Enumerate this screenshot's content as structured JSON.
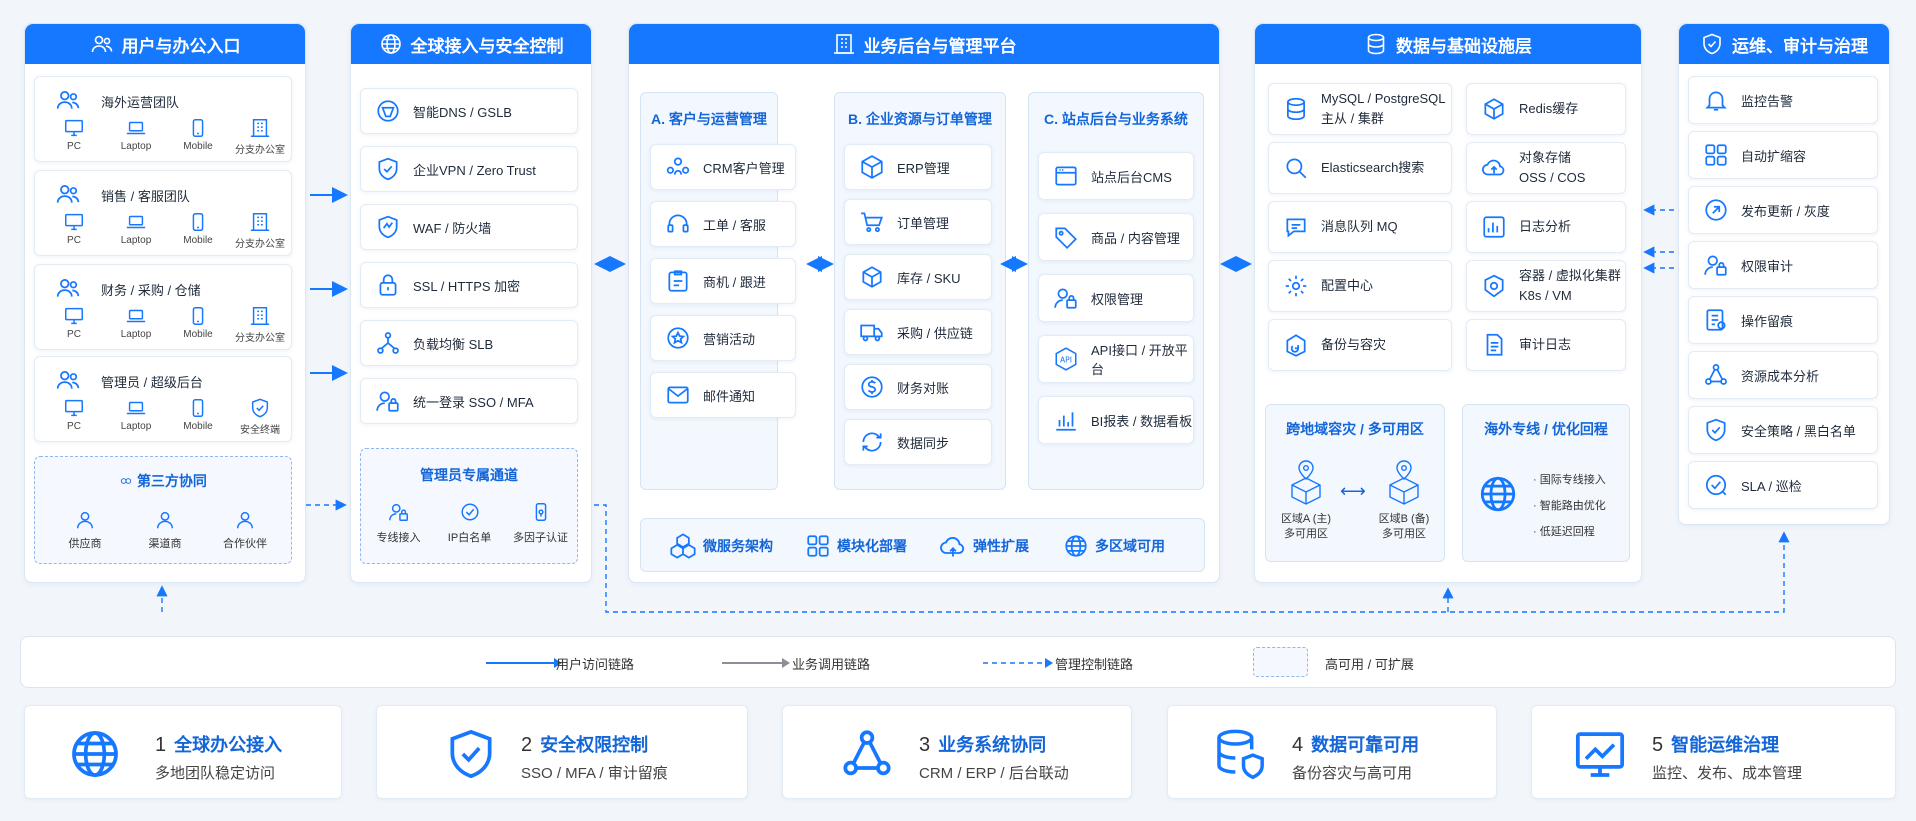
{
  "colors": {
    "accent": "#1677ff",
    "dark_accent": "#1466d8",
    "gray_arrow": "#8a8f98",
    "panel_bg": "#f3f8fe"
  },
  "col1": {
    "title": "用户与办公入口",
    "groups": [
      {
        "title": "海外运营团队",
        "devices": [
          "PC",
          "Laptop",
          "Mobile",
          "分支办公室"
        ]
      },
      {
        "title": "销售 / 客服团队",
        "devices": [
          "PC",
          "Laptop",
          "Mobile",
          "分支办公室"
        ]
      },
      {
        "title": "财务 / 采购 / 仓储",
        "devices": [
          "PC",
          "Laptop",
          "Mobile",
          "分支办公室"
        ]
      },
      {
        "title": "管理员 / 超级后台",
        "devices": [
          "PC",
          "Laptop",
          "Mobile",
          "安全终端"
        ]
      }
    ],
    "third_party": {
      "title": "第三方协同",
      "items": [
        "供应商",
        "渠道商",
        "合作伙伴"
      ]
    }
  },
  "col2": {
    "title": "全球接入与安全控制",
    "items": [
      "智能DNS / GSLB",
      "企业VPN / Zero Trust",
      "WAF / 防火墙",
      "SSL / HTTPS 加密",
      "负载均衡 SLB",
      "统一登录 SSO / MFA"
    ],
    "admin": {
      "title": "管理员专属通道",
      "items": [
        "专线接入",
        "IP白名单",
        "多因子认证"
      ]
    }
  },
  "col3": {
    "title": "业务后台与管理平台",
    "sub_a": {
      "title": "A. 客户与运营管理",
      "items": [
        "CRM客户管理",
        "工单 / 客服",
        "商机 / 跟进",
        "营销活动",
        "邮件通知"
      ]
    },
    "sub_b": {
      "title": "B. 企业资源与订单管理",
      "items": [
        "ERP管理",
        "订单管理",
        "库存 / SKU",
        "采购 / 供应链",
        "财务对账",
        "数据同步"
      ]
    },
    "sub_c": {
      "title": "C. 站点后台与业务系统",
      "items": [
        "站点后台CMS",
        "商品 / 内容管理",
        "权限管理",
        "API接口 / 开放平台",
        "BI报表 / 数据看板"
      ]
    },
    "bottom": [
      "微服务架构",
      "模块化部署",
      "弹性扩展",
      "多区域可用"
    ]
  },
  "col4": {
    "title": "数据与基础设施层",
    "left": [
      "MySQL / PostgreSQL\n主从 / 集群",
      "Elasticsearch搜索",
      "消息队列 MQ",
      "配置中心",
      "备份与容灾"
    ],
    "right": [
      "Redis缓存",
      "对象存储\nOSS / COS",
      "日志分析",
      "容器 / 虚拟化集群\nK8s / VM",
      "审计日志"
    ],
    "dr": {
      "title": "跨地域容灾 / 多可用区",
      "zone_a": "区域A (主)\n多可用区",
      "zone_b": "区域B (备)\n多可用区"
    },
    "line": {
      "title": "海外专线 / 优化回程",
      "items": [
        "国际专线接入",
        "智能路由优化",
        "低延迟回程"
      ]
    }
  },
  "col5": {
    "title": "运维、审计与治理",
    "items": [
      "监控告警",
      "自动扩缩容",
      "发布更新 / 灰度",
      "权限审计",
      "操作留痕",
      "资源成本分析",
      "安全策略 / 黑白名单",
      "SLA / 巡检"
    ]
  },
  "legend": {
    "items": [
      "用户访问链路",
      "业务调用链路",
      "管理控制链路",
      "高可用 / 可扩展"
    ]
  },
  "features": [
    {
      "num": "1",
      "title": "全球办公接入",
      "sub": "多地团队稳定访问"
    },
    {
      "num": "2",
      "title": "安全权限控制",
      "sub": "SSO / MFA / 审计留痕"
    },
    {
      "num": "3",
      "title": "业务系统协同",
      "sub": "CRM / ERP / 后台联动"
    },
    {
      "num": "4",
      "title": "数据可靠可用",
      "sub": "备份容灾与高可用"
    },
    {
      "num": "5",
      "title": "智能运维治理",
      "sub": "监控、发布、成本管理"
    }
  ]
}
